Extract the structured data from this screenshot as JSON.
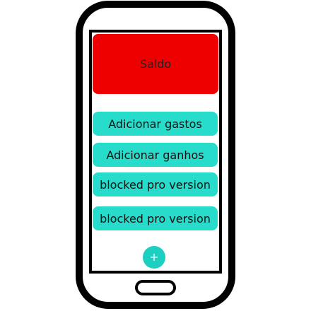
{
  "balance_card": {
    "label": "Saldo",
    "color": "#ee0000"
  },
  "menu": {
    "accent_color": "#28dccb",
    "buttons": [
      {
        "label": "Adicionar gastos"
      },
      {
        "label": "Adicionar ganhos"
      },
      {
        "label": "blocked pro version"
      },
      {
        "label": "blocked pro version"
      }
    ]
  },
  "fab": {
    "icon": "plus-icon",
    "glyph": "+"
  }
}
